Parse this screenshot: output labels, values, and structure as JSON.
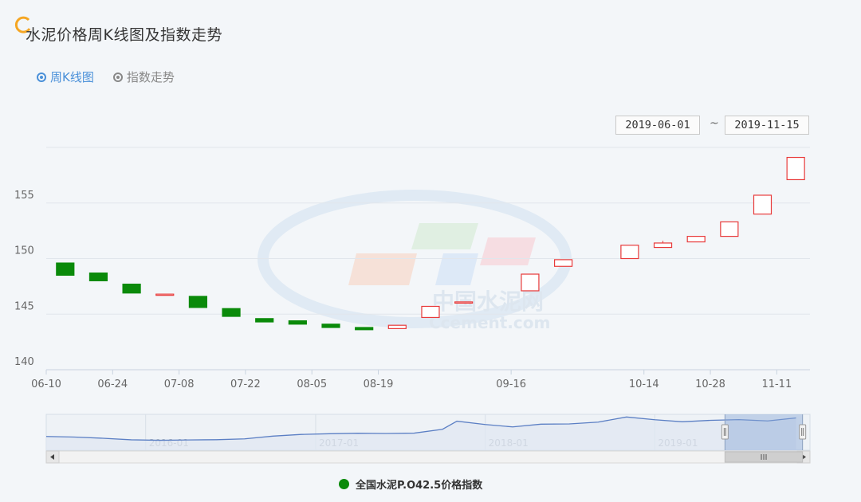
{
  "page": {
    "title": "水泥价格周K线图及指数走势",
    "tabs": [
      {
        "label": "周K线图",
        "selected": true
      },
      {
        "label": "指数走势",
        "selected": false
      }
    ],
    "date_from": "2019-06-01",
    "date_separator": "~",
    "date_to": "2019-11-15",
    "watermark": {
      "cn": "中国水泥网",
      "en": "Ccement.com"
    }
  },
  "colors": {
    "up": "#e83a3a",
    "down": "#0a8a0a",
    "accent": "#4a90d9",
    "navigator_line": "#5b7fc4"
  },
  "chart_data": {
    "type": "candlestick",
    "title": "",
    "ylim": [
      140,
      160
    ],
    "yticks": [
      140,
      145,
      150,
      155
    ],
    "xlim": [
      "2019-06-10",
      "2019-11-18"
    ],
    "xticks": [
      {
        "date": "2019-06-10",
        "label": "06-10"
      },
      {
        "date": "2019-06-24",
        "label": "06-24"
      },
      {
        "date": "2019-07-08",
        "label": "07-08"
      },
      {
        "date": "2019-07-22",
        "label": "07-22"
      },
      {
        "date": "2019-08-05",
        "label": "08-05"
      },
      {
        "date": "2019-08-19",
        "label": "08-19"
      },
      {
        "date": "2019-09-16",
        "label": "09-16"
      },
      {
        "date": "2019-10-14",
        "label": "10-14"
      },
      {
        "date": "2019-10-28",
        "label": "10-28"
      },
      {
        "date": "2019-11-11",
        "label": "11-11"
      }
    ],
    "candles": [
      {
        "date": "2019-06-14",
        "open": 149.6,
        "close": 148.5,
        "high": 149.6,
        "low": 148.5
      },
      {
        "date": "2019-06-21",
        "open": 148.7,
        "close": 148.0,
        "high": 148.7,
        "low": 148.0
      },
      {
        "date": "2019-06-28",
        "open": 147.7,
        "close": 146.9,
        "high": 147.7,
        "low": 146.9
      },
      {
        "date": "2019-07-05",
        "open": 146.8,
        "close": 146.8,
        "high": 146.8,
        "low": 146.8
      },
      {
        "date": "2019-07-12",
        "open": 146.6,
        "close": 145.6,
        "high": 146.6,
        "low": 145.6
      },
      {
        "date": "2019-07-19",
        "open": 145.5,
        "close": 144.8,
        "high": 145.5,
        "low": 144.8
      },
      {
        "date": "2019-07-26",
        "open": 144.6,
        "close": 144.3,
        "high": 144.6,
        "low": 144.3
      },
      {
        "date": "2019-08-02",
        "open": 144.4,
        "close": 144.1,
        "high": 144.4,
        "low": 144.1
      },
      {
        "date": "2019-08-09",
        "open": 144.1,
        "close": 143.8,
        "high": 144.1,
        "low": 143.8
      },
      {
        "date": "2019-08-16",
        "open": 143.8,
        "close": 143.6,
        "high": 143.8,
        "low": 143.6
      },
      {
        "date": "2019-08-23",
        "open": 143.7,
        "close": 144.0,
        "high": 144.0,
        "low": 143.7
      },
      {
        "date": "2019-08-30",
        "open": 144.7,
        "close": 145.7,
        "high": 145.7,
        "low": 144.7
      },
      {
        "date": "2019-09-06",
        "open": 146.0,
        "close": 146.1,
        "high": 146.1,
        "low": 146.0
      },
      {
        "date": "2019-09-20",
        "open": 147.1,
        "close": 148.6,
        "high": 148.6,
        "low": 147.1
      },
      {
        "date": "2019-09-27",
        "open": 149.3,
        "close": 149.9,
        "high": 149.9,
        "low": 149.3
      },
      {
        "date": "2019-10-11",
        "open": 150.0,
        "close": 151.2,
        "high": 151.2,
        "low": 150.0
      },
      {
        "date": "2019-10-18",
        "open": 151.0,
        "close": 151.4,
        "high": 151.6,
        "low": 151.0
      },
      {
        "date": "2019-10-25",
        "open": 151.5,
        "close": 152.0,
        "high": 152.0,
        "low": 151.5
      },
      {
        "date": "2019-11-01",
        "open": 152.0,
        "close": 153.3,
        "high": 153.3,
        "low": 152.0
      },
      {
        "date": "2019-11-08",
        "open": 154.0,
        "close": 155.7,
        "high": 155.7,
        "low": 154.0
      },
      {
        "date": "2019-11-15",
        "open": 157.1,
        "close": 159.1,
        "high": 159.1,
        "low": 157.1
      }
    ],
    "navigator": {
      "labels": [
        "2016-01",
        "2017-01",
        "2018-01",
        "2019-01"
      ],
      "selected_range": [
        "2019-06-01",
        "2019-11-15"
      ],
      "series": [
        {
          "date": "2015-06",
          "value": 131.5
        },
        {
          "date": "2015-08",
          "value": 131.0
        },
        {
          "date": "2015-10",
          "value": 130.0
        },
        {
          "date": "2015-12",
          "value": 128.7
        },
        {
          "date": "2016-02",
          "value": 128.3
        },
        {
          "date": "2016-04",
          "value": 128.6
        },
        {
          "date": "2016-06",
          "value": 128.8
        },
        {
          "date": "2016-08",
          "value": 129.5
        },
        {
          "date": "2016-10",
          "value": 131.8
        },
        {
          "date": "2016-12",
          "value": 133.2
        },
        {
          "date": "2017-02",
          "value": 133.8
        },
        {
          "date": "2017-04",
          "value": 134.2
        },
        {
          "date": "2017-06",
          "value": 134.0
        },
        {
          "date": "2017-08",
          "value": 134.3
        },
        {
          "date": "2017-10",
          "value": 137.5
        },
        {
          "date": "2017-11",
          "value": 144.3
        },
        {
          "date": "2018-01",
          "value": 141.5
        },
        {
          "date": "2018-03",
          "value": 139.5
        },
        {
          "date": "2018-05",
          "value": 141.8
        },
        {
          "date": "2018-07",
          "value": 142.0
        },
        {
          "date": "2018-09",
          "value": 143.5
        },
        {
          "date": "2018-11",
          "value": 147.8
        },
        {
          "date": "2019-01",
          "value": 145.5
        },
        {
          "date": "2019-03",
          "value": 143.8
        },
        {
          "date": "2019-05",
          "value": 145.0
        },
        {
          "date": "2019-07",
          "value": 145.6
        },
        {
          "date": "2019-09",
          "value": 144.5
        },
        {
          "date": "2019-11",
          "value": 147.0
        }
      ]
    },
    "legend": {
      "label": "全国水泥P.O42.5价格指数",
      "position": "bottom-center"
    }
  }
}
